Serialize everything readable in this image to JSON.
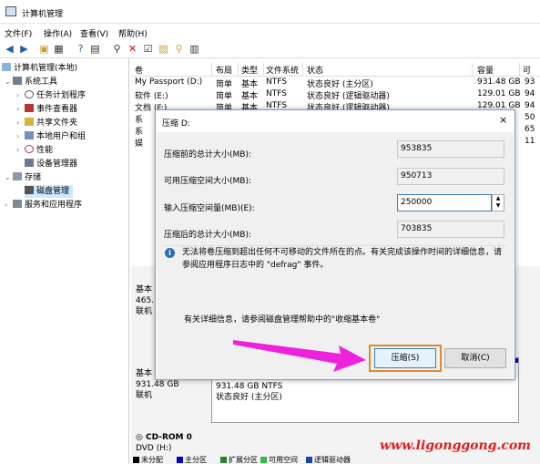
{
  "window": {
    "title": "计算机管理"
  },
  "menu": [
    "文件(F)",
    "操作(A)",
    "查看(V)",
    "帮助(H)"
  ],
  "tree": {
    "root": "计算机管理(本地)",
    "system_tools": "系统工具",
    "task_scheduler": "任务计划程序",
    "event_viewer": "事件查看器",
    "shared_folders": "共享文件夹",
    "local_users": "本地用户和组",
    "performance": "性能",
    "device_manager": "设备管理器",
    "storage": "存储",
    "disk_management": "磁盘管理",
    "services": "服务和应用程序"
  },
  "columns": [
    "卷",
    "布局",
    "类型",
    "文件系统",
    "状态",
    "容量",
    "可"
  ],
  "volumes": [
    {
      "name": "My Passport (D:)",
      "layout": "简单",
      "type": "基本",
      "fs": "NTFS",
      "status": "状态良好 (主分区)",
      "capacity": "931.48 GB",
      "free": "93"
    },
    {
      "name": "软件 (E:)",
      "layout": "简单",
      "type": "基本",
      "fs": "NTFS",
      "status": "状态良好 (逻辑驱动器)",
      "capacity": "129.01 GB",
      "free": "94"
    },
    {
      "name": "文档 (F:)",
      "layout": "简单",
      "type": "基本",
      "fs": "NTFS",
      "status": "状态良好 (逻辑驱动器)",
      "capacity": "129.01 GB",
      "free": "94"
    },
    {
      "name": "系",
      "layout": "",
      "type": "",
      "fs": "",
      "status": "",
      "capacity": "",
      "free": "50"
    },
    {
      "name": "系",
      "layout": "",
      "type": "",
      "fs": "",
      "status": "",
      "capacity": "",
      "free": "65"
    },
    {
      "name": "娱",
      "layout": "",
      "type": "",
      "fs": "",
      "status": "",
      "capacity": "",
      "free": "11"
    }
  ],
  "disks": [
    {
      "label": "基本",
      "size": "465.",
      "state": "联机"
    },
    {
      "label": "基本",
      "size": "931.48 GB",
      "state": "联机",
      "part_size": "931.48 GB NTFS",
      "part_status": "状态良好 (主分区)"
    },
    {
      "label": "CD-ROM 0",
      "size": "DVD (H:)",
      "state": ""
    }
  ],
  "legend": [
    "未分配",
    "主分区",
    "扩展分区",
    "可用空间",
    "逻辑驱动器"
  ],
  "legend_colors": [
    "#000000",
    "#0000c8",
    "#2e7d32",
    "#39b54a",
    "#1f3fb5"
  ],
  "dialog": {
    "title": "压缩 D:",
    "close": "×",
    "total_before_label": "压缩前的总计大小(MB):",
    "total_before": "953835",
    "available_label": "可用压缩空间大小(MB):",
    "available": "950713",
    "amount_label": "输入压缩空间量(MB)(E):",
    "amount": "250000",
    "total_after_label": "压缩后的总计大小(MB):",
    "total_after": "703835",
    "info_icon": "i",
    "info": "无法将卷压缩到超出任何不可移动的文件所在的点。有关完成该操作时间的详细信息，请参阅应用程序日志中的 \"defrag\" 事件。",
    "help": "有关详细信息，请参阅磁盘管理帮助中的\"收缩基本卷\"",
    "shrink_button": "压缩(S)",
    "cancel_button": "取消(C)"
  },
  "watermark": "www.ligonggong.com"
}
